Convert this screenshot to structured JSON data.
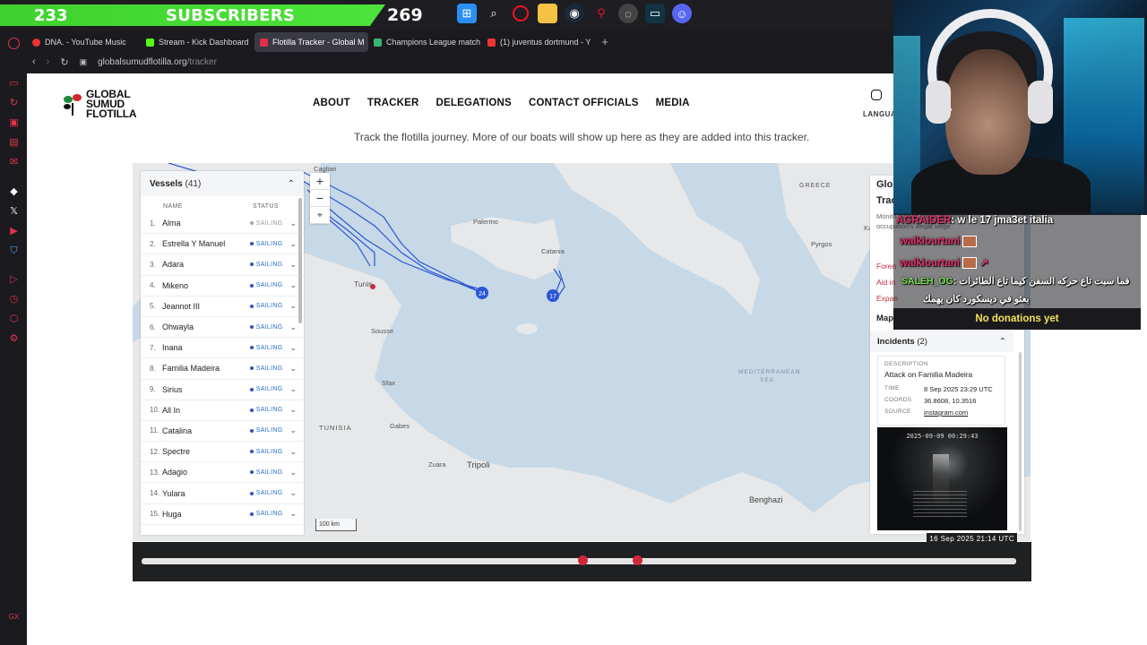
{
  "overlay": {
    "subscribers_count": "233",
    "subscribers_label": "SUBSCRIBERS",
    "subscribers_goal": "269",
    "taskbar_icons": [
      "windows-icon",
      "search-icon",
      "opera-icon",
      "folder-icon",
      "steam-icon",
      "maps-pin-icon",
      "browser-icon",
      "terminal-icon",
      "discord-icon"
    ]
  },
  "browser": {
    "tabs": [
      {
        "label": "DNA. - YouTube Music",
        "color": "#e33"
      },
      {
        "label": "Stream - Kick Dashboard",
        "color": "#53fc18"
      },
      {
        "label": "Flotilla Tracker - Global M",
        "color": "#e22d4b"
      },
      {
        "label": "Champions League match",
        "color": "#3cb371"
      },
      {
        "label": "(1) juventus dortmund - Y",
        "color": "#e33"
      }
    ],
    "url_host": "globalsumudflotilla.org",
    "url_path": "/tracker"
  },
  "site": {
    "logo_line1": "GLOBAL",
    "logo_line2": "SUMUD",
    "logo_line3": "FLOTILLA",
    "nav": [
      "ABOUT",
      "TRACKER",
      "DELEGATIONS",
      "CONTACT OFFICIALS",
      "MEDIA"
    ],
    "language_label": "LANGUA",
    "blurb": "Track the flotilla journey. More of our boats will show up here as they are added into this tracker."
  },
  "vessels": {
    "title": "Vessels",
    "count": "(41)",
    "col_name": "NAME",
    "col_status": "STATUS",
    "items": [
      {
        "num": "1.",
        "name": "Alma",
        "status": "SAILING",
        "dot": "grey"
      },
      {
        "num": "2.",
        "name": "Estrella Y Manuel",
        "status": "SAILING",
        "dot": "blue"
      },
      {
        "num": "3.",
        "name": "Adara",
        "status": "SAILING",
        "dot": "blue"
      },
      {
        "num": "4.",
        "name": "Mikeno",
        "status": "SAILING",
        "dot": "blue"
      },
      {
        "num": "5.",
        "name": "Jeannot III",
        "status": "SAILING",
        "dot": "blue"
      },
      {
        "num": "6.",
        "name": "Ohwayla",
        "status": "SAILING",
        "dot": "blue"
      },
      {
        "num": "7.",
        "name": "Inana",
        "status": "SAILING",
        "dot": "blue"
      },
      {
        "num": "8.",
        "name": "Familia Madeira",
        "status": "SAILING",
        "dot": "blue"
      },
      {
        "num": "9.",
        "name": "Sirius",
        "status": "SAILING",
        "dot": "blue"
      },
      {
        "num": "10.",
        "name": "All In",
        "status": "SAILING",
        "dot": "blue"
      },
      {
        "num": "11.",
        "name": "Catalina",
        "status": "SAILING",
        "dot": "blue"
      },
      {
        "num": "12.",
        "name": "Spectre",
        "status": "SAILING",
        "dot": "blue"
      },
      {
        "num": "13.",
        "name": "Adagio",
        "status": "SAILING",
        "dot": "blue"
      },
      {
        "num": "14.",
        "name": "Yulara",
        "status": "SAILING",
        "dot": "blue"
      },
      {
        "num": "15.",
        "name": "Huga",
        "status": "SAILING",
        "dot": "blue"
      }
    ]
  },
  "map": {
    "zoom_in": "+",
    "zoom_out": "−",
    "reset": "⌖",
    "scale": "100 km",
    "labels": {
      "cagliari": "Cagliari",
      "palermo": "Palermo",
      "catania": "Catania",
      "tunis": "Tunis",
      "sousse": "Sousse",
      "sfax": "Sfax",
      "gabes": "Gabes",
      "tunisia": "TUNISIA",
      "zuara": "Zuara",
      "tripoli": "Tripoli",
      "benghazi": "Benghazi",
      "greece": "GREECE",
      "kalamata": "Kalamata",
      "pyrgos": "Pyrgos",
      "medsea": "MEDITERRANEAN",
      "medsea2": "SEA"
    },
    "marker_a": "24",
    "marker_b": "17"
  },
  "info": {
    "title1": "Glo",
    "title2": "Trac",
    "text": "Monito nonvio break the Israeli occupation's illegal siege",
    "links": [
      "Foren",
      "Aid in",
      "Expan"
    ],
    "maps_label": "Map",
    "incidents_title": "Incidents",
    "incidents_count": "(2)",
    "desc_label": "DESCRIPTION",
    "incident_title": "Attack on Familia Madeira",
    "time_label": "TIME",
    "time_value": "8 Sep 2025 23:29 UTC",
    "coords_label": "COORDS",
    "coords_value": "36.8608, 10.3516",
    "source_label": "SOURCE",
    "source_value": "instagram.com",
    "image_timestamp": "2025-09-09 00:29:43"
  },
  "timeline": {
    "date": "16 Sep 2025 21:14 UTC",
    "markers": [
      0.504,
      0.567
    ]
  },
  "chat": {
    "lines": [
      {
        "name": "AGRAIDER",
        "text": ": w le 17 jma3et italia",
        "green": false
      },
      {
        "name": "walkiourtani",
        "text": "",
        "green": false
      },
      {
        "name": "walkiourtani",
        "text": "↗",
        "green": false
      },
      {
        "name": "SALEH_OG",
        "text": ": فما سبت تاع حركه السفن كيما تاع الطائرات",
        "green": true
      },
      {
        "name": "",
        "text": "بعثو في ديسكورد كان يهمك",
        "green": false
      }
    ],
    "donations": "No donations yet"
  }
}
